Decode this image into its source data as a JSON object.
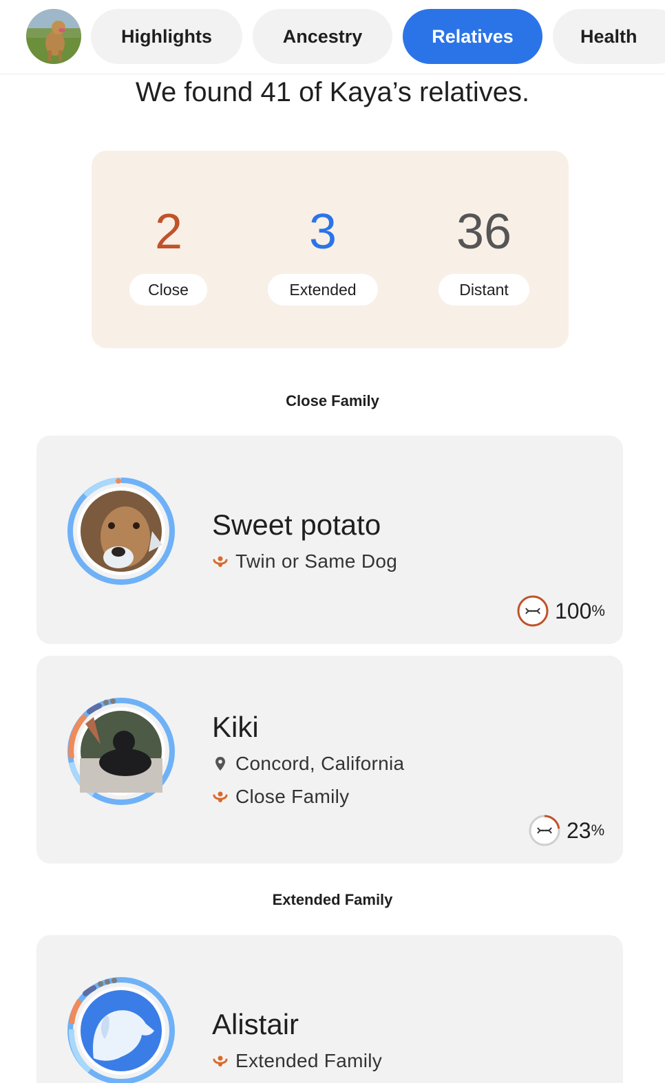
{
  "nav": {
    "tabs": [
      {
        "label": "Highlights"
      },
      {
        "label": "Ancestry"
      },
      {
        "label": "Relatives",
        "active": true
      },
      {
        "label": "Health"
      }
    ],
    "accent_color": "#2b74e8"
  },
  "headline": "We found 41 of Kaya’s relatives.",
  "summary": {
    "close": {
      "count": "2",
      "label": "Close",
      "color": "#c0532a"
    },
    "extended": {
      "count": "3",
      "label": "Extended",
      "color": "#2b74e8"
    },
    "distant": {
      "count": "36",
      "label": "Distant",
      "color": "#555555"
    }
  },
  "sections": {
    "close_title": "Close Family",
    "extended_title": "Extended Family"
  },
  "relatives": [
    {
      "name": "Sweet potato",
      "relationship": "Twin or Same Dog",
      "location": "",
      "shared_value": "100",
      "shared_unit": "%",
      "shared_fraction": 1.0,
      "icon": "dna-icon"
    },
    {
      "name": "Kiki",
      "relationship": "Close Family",
      "location": "Concord, California",
      "shared_value": "23",
      "shared_unit": "%",
      "shared_fraction": 0.23,
      "icon": "dna-icon"
    },
    {
      "name": "Alistair",
      "relationship": "Extended Family",
      "location": "",
      "icon": "dog-silhouette-icon"
    }
  ]
}
